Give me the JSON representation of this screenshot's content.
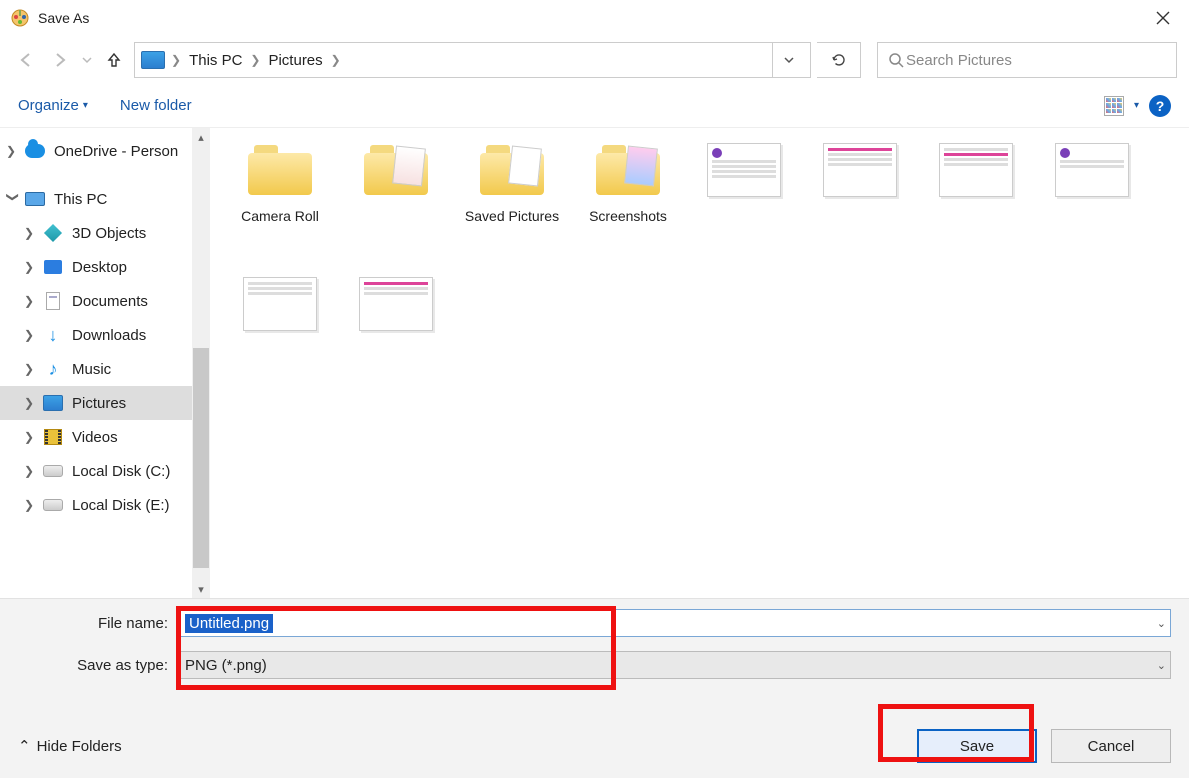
{
  "title": "Save As",
  "breadcrumb": {
    "root": "This PC",
    "folder": "Pictures"
  },
  "search": {
    "placeholder": "Search Pictures"
  },
  "toolbar": {
    "organize": "Organize",
    "newfolder": "New folder"
  },
  "tree": {
    "onedrive": "OneDrive - Person",
    "thispc": "This PC",
    "items": [
      "3D Objects",
      "Desktop",
      "Documents",
      "Downloads",
      "Music",
      "Pictures",
      "Videos",
      "Local Disk (C:)",
      "Local Disk (E:)"
    ]
  },
  "files": {
    "folders": [
      "Camera Roll",
      "",
      "Saved Pictures",
      "Screenshots"
    ],
    "images": [
      "",
      "",
      "",
      ""
    ]
  },
  "form": {
    "filename_label": "File name:",
    "filename_value": "Untitled.png",
    "type_label": "Save as type:",
    "type_value": "PNG (*.png)"
  },
  "footer": {
    "hide": "Hide Folders",
    "save": "Save",
    "cancel": "Cancel"
  }
}
